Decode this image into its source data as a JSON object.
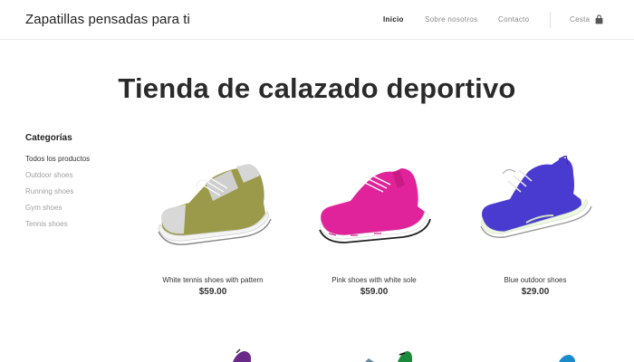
{
  "header": {
    "brand": "Zapatillas pensadas para ti",
    "nav": [
      {
        "label": "Inicio",
        "active": true
      },
      {
        "label": "Sobre nosotros",
        "active": false
      },
      {
        "label": "Contacto",
        "active": false
      }
    ],
    "cart_label": "Cesta",
    "cart_icon": "shopping-bag-icon"
  },
  "page_title": "Tienda de calazado deportivo",
  "sidebar": {
    "heading": "Categorías",
    "items": [
      {
        "label": "Todos los productos",
        "active": true
      },
      {
        "label": "Outdoor shoes",
        "active": false
      },
      {
        "label": "Running shoes",
        "active": false
      },
      {
        "label": "Gym shoes",
        "active": false
      },
      {
        "label": "Tennis shoes",
        "active": false
      }
    ]
  },
  "products": [
    {
      "name": "White tennis shoes with pattern",
      "price": "$59.00",
      "color": "#9a9a4a"
    },
    {
      "name": "Pink shoes with white sole",
      "price": "$59.00",
      "color": "#e0239a"
    },
    {
      "name": "Blue outdoor shoes",
      "price": "$29.00",
      "color": "#4a3bd0"
    }
  ],
  "colors": {
    "text": "#222222",
    "muted": "#a0a0a0",
    "border": "#ececec"
  }
}
